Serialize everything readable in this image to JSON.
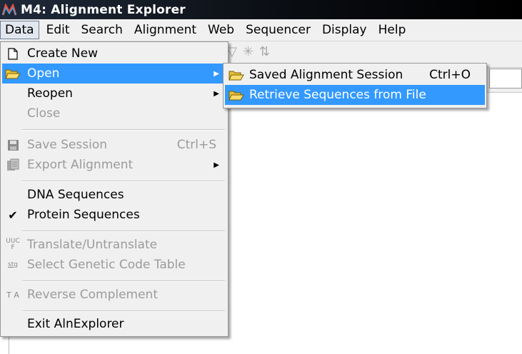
{
  "window": {
    "title": "M4: Alignment Explorer",
    "app_icon": "mega-logo-icon"
  },
  "menubar": {
    "items": [
      "Data",
      "Edit",
      "Search",
      "Alignment",
      "Web",
      "Sequencer",
      "Display",
      "Help"
    ],
    "active": "Data"
  },
  "data_menu": {
    "create_new": "Create New",
    "open": "Open",
    "reopen": "Reopen",
    "close": "Close",
    "save_session": "Save Session",
    "save_session_shortcut": "Ctrl+S",
    "export_alignment": "Export Alignment",
    "dna_sequences": "DNA Sequences",
    "protein_sequences": "Protein Sequences",
    "protein_checked": true,
    "translate": "Translate/Untranslate",
    "translate_icon_text": "UUC F",
    "select_code": "Select Genetic Code Table",
    "select_code_icon_text": "stg",
    "reverse_complement": "Reverse Complement",
    "reverse_icon_text": "T A",
    "exit": "Exit AlnExplorer"
  },
  "open_submenu": {
    "saved_session": "Saved Alignment Session",
    "saved_session_shortcut": "Ctrl+O",
    "retrieve_file": "Retrieve Sequences from File"
  },
  "colors": {
    "highlight": "#3399ff",
    "menu_bg": "#f0f0f0",
    "disabled_text": "#9b9b9b"
  }
}
